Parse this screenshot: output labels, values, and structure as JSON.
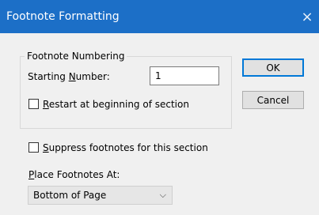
{
  "window": {
    "title": "Footnote Formatting",
    "close_label": "×"
  },
  "numbering_group": {
    "title": "Footnote Numbering",
    "starting_number_label_prefix": "Starting ",
    "starting_number_label_accel": "N",
    "starting_number_label_rest": "umber:",
    "starting_number_value": "1",
    "restart_label_accel": "R",
    "restart_label_rest": "estart at beginning of section",
    "restart_checked": false
  },
  "suppress": {
    "label_accel": "S",
    "label_rest": "uppress footnotes for this section",
    "checked": false
  },
  "placement": {
    "label_accel": "P",
    "label_rest": "lace Footnotes At:",
    "selected": "Bottom of Page",
    "chevron": "⌵"
  },
  "buttons": {
    "ok": "OK",
    "cancel": "Cancel"
  }
}
